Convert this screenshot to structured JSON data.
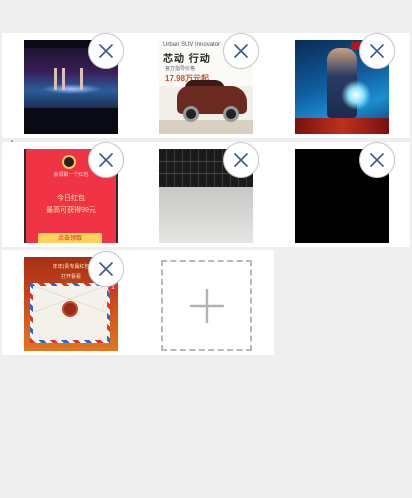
{
  "photo_grid": {
    "items": [
      {
        "name": "video-clip",
        "kind": "video"
      },
      {
        "name": "car-ad",
        "kind": "image",
        "texts": {
          "en": "Urban SUV Innovator",
          "cn": "芯动 行动",
          "sub": "官方指导价格",
          "price": "17.98万元起"
        }
      },
      {
        "name": "game-art",
        "kind": "image"
      },
      {
        "name": "red-packet",
        "kind": "image",
        "texts": {
          "line1": "会领取一个红包",
          "line2": "今日红包",
          "line3": "最高可获得99元",
          "button": "点击领取"
        }
      },
      {
        "name": "keyboard-photo",
        "kind": "image"
      },
      {
        "name": "black-image",
        "kind": "image"
      },
      {
        "name": "envelope-ad",
        "kind": "image",
        "texts": {
          "line1": "年年)贵专属红包",
          "line2": "打开看看",
          "badge": "1"
        }
      }
    ],
    "remove_icon": "close-icon",
    "add_icon": "plus-icon"
  },
  "colors": {
    "background": "#efefef",
    "row": "#ffffff",
    "close_icon": "#3b5a8a",
    "add_border": "#b9b9b9",
    "add_icon": "#b3b3b3"
  }
}
